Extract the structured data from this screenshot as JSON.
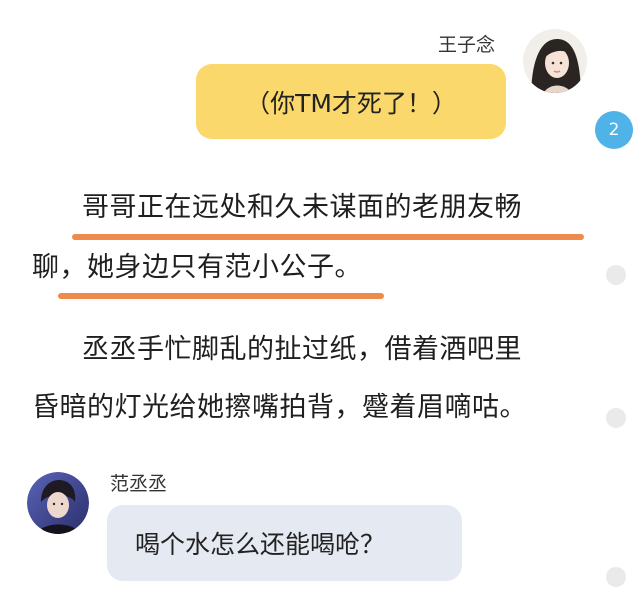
{
  "messages": {
    "top": {
      "sender": "王子念",
      "text": "（你TM才死了！）"
    },
    "bottom": {
      "sender": "范丞丞",
      "text": "喝个水怎么还能喝呛？"
    }
  },
  "narration": {
    "p1_line1": "哥哥正在远处和久未谋面的老朋友畅",
    "p1_line2": "聊，她身边只有范小公子。",
    "p2_line1": "丞丞手忙脚乱的扯过纸，借着酒吧里",
    "p2_line2": "昏暗的灯光给她擦嘴拍背，蹙着眉嘀咕。"
  },
  "comments": {
    "badge_count": "2"
  },
  "colors": {
    "yellow_bubble": "#fbd86b",
    "grey_bubble": "#e5e9f1",
    "underline": "#ee8a4a",
    "badge": "#4fb3e8"
  }
}
